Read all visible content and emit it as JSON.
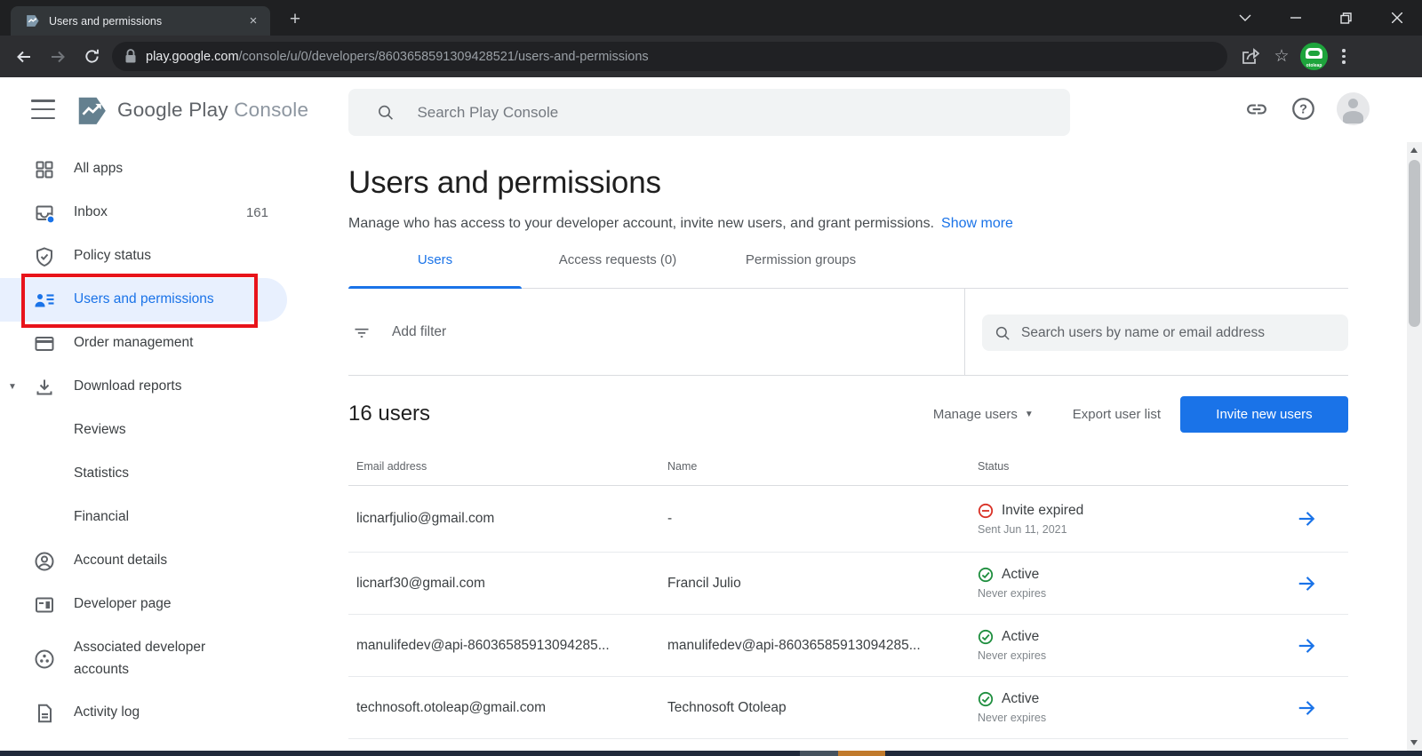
{
  "browser": {
    "tab_title": "Users and permissions",
    "url_domain": "play.google.com",
    "url_path": "/console/u/0/developers/8603658591309428521/users-and-permissions",
    "profile_avatar_label": "otoleap"
  },
  "app_header": {
    "brand": "Google Play",
    "brand_suffix": "Console",
    "search_placeholder": "Search Play Console"
  },
  "sidebar": {
    "items": [
      {
        "label": "All apps"
      },
      {
        "label": "Inbox",
        "badge": "161"
      },
      {
        "label": "Policy status"
      },
      {
        "label": "Users and permissions"
      },
      {
        "label": "Order management"
      },
      {
        "label": "Download reports"
      },
      {
        "label": "Reviews"
      },
      {
        "label": "Statistics"
      },
      {
        "label": "Financial"
      },
      {
        "label": "Account details"
      },
      {
        "label": "Developer page"
      },
      {
        "label": "Associated developer accounts"
      },
      {
        "label": "Activity log"
      }
    ]
  },
  "main": {
    "title": "Users and permissions",
    "subtitle": "Manage who has access to your developer account, invite new users, and grant permissions.",
    "show_more_label": "Show more",
    "tabs": [
      {
        "label": "Users"
      },
      {
        "label": "Access requests (0)"
      },
      {
        "label": "Permission groups"
      }
    ],
    "filter_bar": {
      "add_filter_label": "Add filter",
      "user_search_placeholder": "Search users by name or email address"
    },
    "users_header": {
      "count_label": "16 users",
      "manage_users_label": "Manage users",
      "export_label": "Export user list",
      "invite_label": "Invite new users"
    },
    "table": {
      "columns": [
        "Email address",
        "Name",
        "Status"
      ],
      "rows": [
        {
          "email": "licnarfjulio@gmail.com",
          "name": "-",
          "status": "Invite expired",
          "status_detail": "Sent Jun 11, 2021"
        },
        {
          "email": "licnarf30@gmail.com",
          "name": "Francil Julio",
          "status": "Active",
          "status_detail": "Never expires"
        },
        {
          "email": "manulifedev@api-86036585913094285...",
          "name": "manulifedev@api-86036585913094285...",
          "status": "Active",
          "status_detail": "Never expires"
        },
        {
          "email": "technosoft.otoleap@gmail.com",
          "name": "Technosoft Otoleap",
          "status": "Active",
          "status_detail": "Never expires"
        }
      ]
    }
  },
  "colors": {
    "accent_blue": "#1a73e8",
    "active_item_bg": "#e8f0fe",
    "annotation_red": "#e8131a",
    "status_active_green": "#1e8e3e",
    "status_expired_red": "#d93025",
    "taskbar_sliver": "#20293a"
  }
}
